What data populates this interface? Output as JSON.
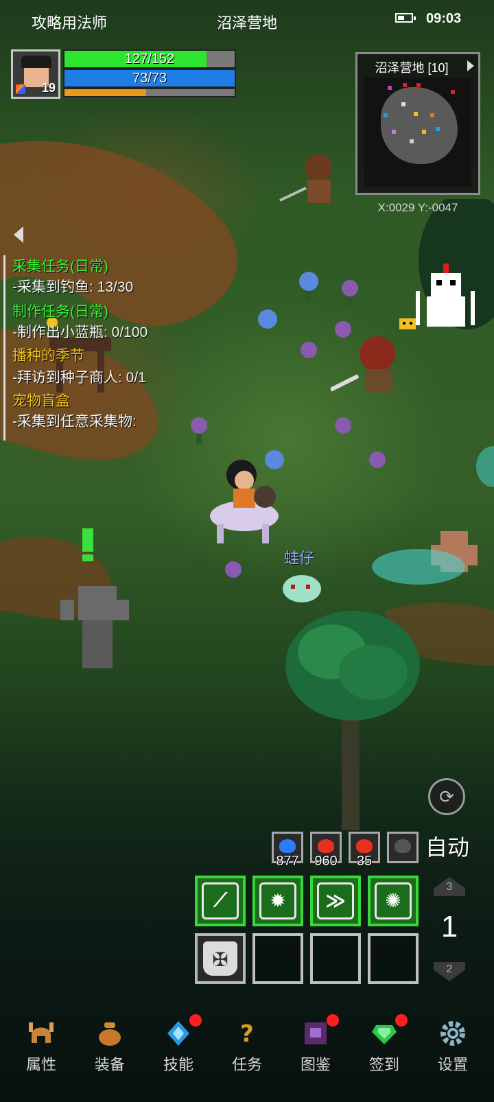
{
  "status": {
    "character_name": "攻略用法师",
    "zone_name": "沼泽营地",
    "clock": "09:03",
    "battery_icon": "battery-icon"
  },
  "player": {
    "level": "19",
    "hp_text": "127/152",
    "hp_fraction": 0.836,
    "mp_text": "73/73",
    "mp_fraction": 1.0,
    "xp_fraction": 0.48,
    "hp_color": "#2ee62e",
    "mp_color": "#1e7ee6",
    "xp_color": "#e69a1e"
  },
  "minimap": {
    "title": "沼泽营地 [10]",
    "coords": "X:0029  Y:-0047"
  },
  "quests": [
    {
      "text": "采集任务(日常)",
      "style": "green"
    },
    {
      "text": "-采集到钓鱼: 13/30",
      "style": "white"
    },
    {
      "text": "制作任务(日常)",
      "style": "green"
    },
    {
      "text": "-制作出小蓝瓶: 0/100",
      "style": "white"
    },
    {
      "text": "播种的季节",
      "style": "gold"
    },
    {
      "text": "-拜访到种子商人: 0/1",
      "style": "white"
    },
    {
      "text": "宠物盲盒",
      "style": "gold"
    },
    {
      "text": "-采集到任意采集物:",
      "style": "white"
    }
  ],
  "pet": {
    "name": "蛙仔"
  },
  "controls": {
    "auto_label": "自动",
    "page_current": "1",
    "page_up": "3",
    "page_down": "2"
  },
  "consumables": [
    {
      "count": "877",
      "color": "#2a7cff",
      "icon": "blue-potion-icon"
    },
    {
      "count": "960",
      "color": "#e8301e",
      "icon": "red-potion-icon"
    },
    {
      "count": "35",
      "color": "#e8301e",
      "icon": "red-potion-icon"
    },
    {
      "count": "",
      "color": "#555555",
      "icon": "empty-slot-icon"
    }
  ],
  "skills": [
    {
      "icon": "slash-skill-icon",
      "state": "active"
    },
    {
      "icon": "burst-skill-icon",
      "state": "active"
    },
    {
      "icon": "dash-skill-icon",
      "state": "active"
    },
    {
      "icon": "radiance-skill-icon",
      "state": "active"
    },
    {
      "icon": "shield-skill-icon",
      "state": "ready"
    },
    {
      "icon": "",
      "state": "empty"
    },
    {
      "icon": "",
      "state": "empty"
    },
    {
      "icon": "",
      "state": "empty"
    }
  ],
  "nav": [
    {
      "label": "属性",
      "icon": "helmet-icon",
      "badge": false
    },
    {
      "label": "装备",
      "icon": "bag-icon",
      "badge": false
    },
    {
      "label": "技能",
      "icon": "gem-icon",
      "badge": true
    },
    {
      "label": "任务",
      "icon": "question-icon",
      "badge": false
    },
    {
      "label": "图鉴",
      "icon": "book-icon",
      "badge": true
    },
    {
      "label": "签到",
      "icon": "emerald-icon",
      "badge": true
    },
    {
      "label": "设置",
      "icon": "gear-icon",
      "badge": false
    }
  ]
}
